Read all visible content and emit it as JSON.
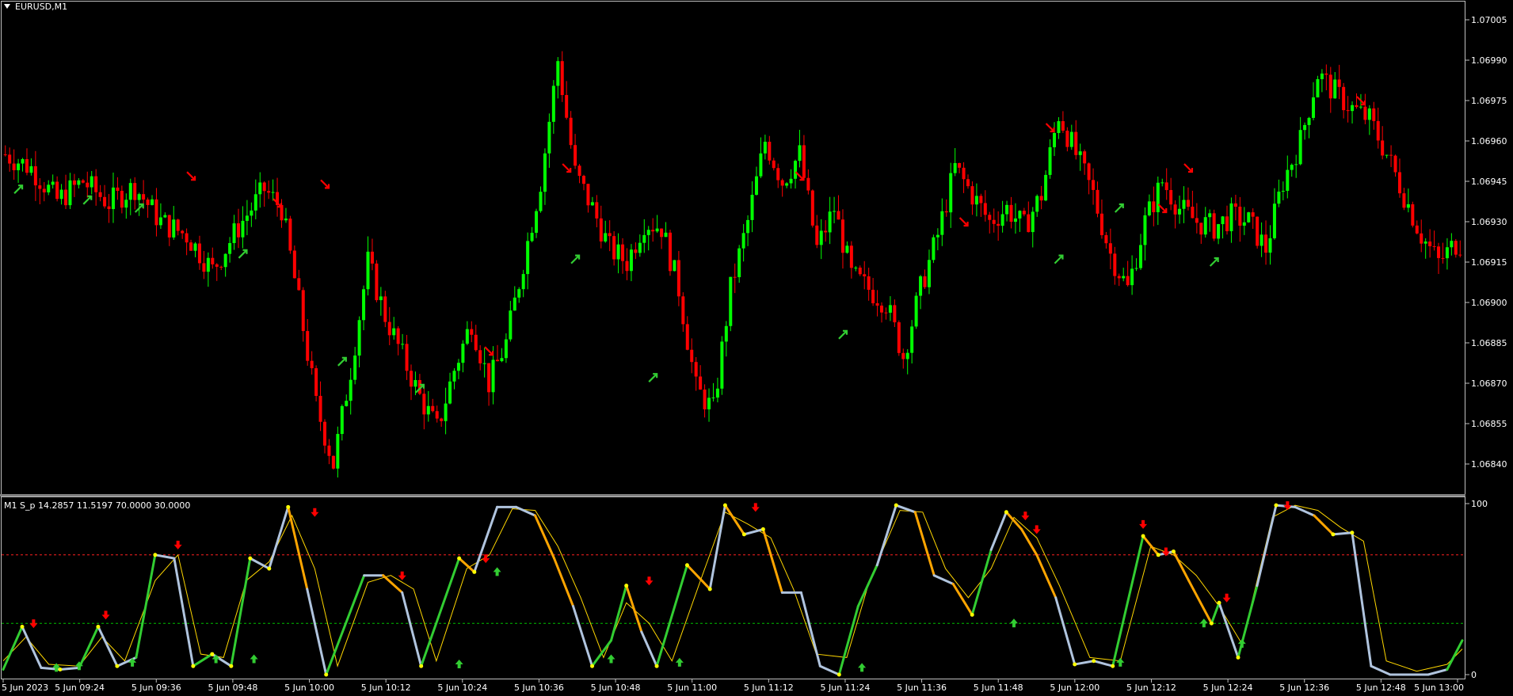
{
  "chart_window": {
    "symbol_label": "EURUSD,M1",
    "indicator_label": "M1 S_p 14.2857 11.5197 70.0000 30.0000"
  },
  "colors": {
    "background": "#000000",
    "frame": "#c0c0c0",
    "bull_candle": "#00ff00",
    "bear_candle": "#ff0000",
    "arrow_buy": "#32cd32",
    "arrow_sell": "#ff0000",
    "osc_main_up": "#32cd32",
    "osc_main_down": "#ffa500",
    "osc_main_flat": "#b0c4de",
    "osc_signal": "#ffd700",
    "level_high": "#ff2020",
    "level_low": "#00c000"
  },
  "chart_data": [
    {
      "type": "candlestick",
      "title": "EURUSD,M1",
      "ylim": [
        1.0683,
        1.0701
      ],
      "y_ticks": [
        "1.07005",
        "1.06990",
        "1.06975",
        "1.06960",
        "1.06945",
        "1.06930",
        "1.06915",
        "1.06900",
        "1.06885",
        "1.06870",
        "1.06855",
        "1.06840"
      ],
      "close_path": [
        [
          0,
          1.06955
        ],
        [
          6,
          1.0695
        ],
        [
          12,
          1.06938
        ],
        [
          18,
          1.06945
        ],
        [
          24,
          1.06937
        ],
        [
          30,
          1.06943
        ],
        [
          36,
          1.0693
        ],
        [
          42,
          1.06925
        ],
        [
          48,
          1.06912
        ],
        [
          54,
          1.06928
        ],
        [
          60,
          1.06942
        ],
        [
          64,
          1.06935
        ],
        [
          68,
          1.069
        ],
        [
          72,
          1.06862
        ],
        [
          76,
          1.0684
        ],
        [
          80,
          1.06875
        ],
        [
          84,
          1.06915
        ],
        [
          88,
          1.06895
        ],
        [
          92,
          1.0688
        ],
        [
          96,
          1.06865
        ],
        [
          100,
          1.06853
        ],
        [
          104,
          1.06875
        ],
        [
          108,
          1.06893
        ],
        [
          112,
          1.0687
        ],
        [
          116,
          1.06885
        ],
        [
          120,
          1.06915
        ],
        [
          124,
          1.06945
        ],
        [
          128,
          1.0699
        ],
        [
          132,
          1.06948
        ],
        [
          136,
          1.06935
        ],
        [
          140,
          1.0692
        ],
        [
          144,
          1.06915
        ],
        [
          148,
          1.0693
        ],
        [
          152,
          1.06928
        ],
        [
          156,
          1.06905
        ],
        [
          160,
          1.06868
        ],
        [
          164,
          1.0686
        ],
        [
          168,
          1.06905
        ],
        [
          172,
          1.0693
        ],
        [
          176,
          1.0696
        ],
        [
          180,
          1.06945
        ],
        [
          184,
          1.06955
        ],
        [
          188,
          1.0692
        ],
        [
          192,
          1.06935
        ],
        [
          196,
          1.0691
        ],
        [
          200,
          1.06905
        ],
        [
          204,
          1.069
        ],
        [
          208,
          1.0688
        ],
        [
          212,
          1.06905
        ],
        [
          216,
          1.06925
        ],
        [
          220,
          1.0695
        ],
        [
          224,
          1.0694
        ],
        [
          228,
          1.0693
        ],
        [
          232,
          1.06935
        ],
        [
          236,
          1.06928
        ],
        [
          240,
          1.0694
        ],
        [
          244,
          1.0697
        ],
        [
          248,
          1.06955
        ],
        [
          252,
          1.0694
        ],
        [
          256,
          1.06918
        ],
        [
          260,
          1.06905
        ],
        [
          264,
          1.0693
        ],
        [
          268,
          1.06945
        ],
        [
          272,
          1.06935
        ],
        [
          276,
          1.0693
        ],
        [
          280,
          1.06928
        ],
        [
          284,
          1.06932
        ],
        [
          288,
          1.0693
        ],
        [
          292,
          1.0692
        ],
        [
          296,
          1.06945
        ],
        [
          300,
          1.0696
        ],
        [
          304,
          1.06985
        ],
        [
          308,
          1.06978
        ],
        [
          312,
          1.06972
        ],
        [
          316,
          1.06968
        ],
        [
          320,
          1.06955
        ],
        [
          324,
          1.0694
        ],
        [
          328,
          1.06925
        ],
        [
          332,
          1.06915
        ],
        [
          336,
          1.06922
        ]
      ],
      "buy_arrows": [
        [
          3,
          1.06942
        ],
        [
          19,
          1.06938
        ],
        [
          31,
          1.06935
        ],
        [
          55,
          1.06918
        ],
        [
          78,
          1.06878
        ],
        [
          96,
          1.06868
        ],
        [
          132,
          1.06916
        ],
        [
          150,
          1.06872
        ],
        [
          194,
          1.06888
        ],
        [
          244,
          1.06916
        ],
        [
          258,
          1.06935
        ],
        [
          280,
          1.06915
        ]
      ],
      "sell_arrows": [
        [
          43,
          1.06947
        ],
        [
          63,
          1.06937
        ],
        [
          74,
          1.06944
        ],
        [
          112,
          1.06882
        ],
        [
          130,
          1.0695
        ],
        [
          184,
          1.06947
        ],
        [
          222,
          1.0693
        ],
        [
          242,
          1.06965
        ],
        [
          268,
          1.06935
        ],
        [
          274,
          1.0695
        ],
        [
          314,
          1.06975
        ]
      ],
      "x_ticks": [
        "5 Jun 2023",
        "5 Jun 09:24",
        "5 Jun 09:36",
        "5 Jun 09:48",
        "5 Jun 10:00",
        "5 Jun 10:12",
        "5 Jun 10:24",
        "5 Jun 10:36",
        "5 Jun 10:48",
        "5 Jun 11:00",
        "5 Jun 11:12",
        "5 Jun 11:24",
        "5 Jun 11:36",
        "5 Jun 11:48",
        "5 Jun 12:00",
        "5 Jun 12:12",
        "5 Jun 12:24",
        "5 Jun 12:36",
        "5 Jun 12:48",
        "5 Jun 13:00"
      ]
    },
    {
      "type": "line",
      "title": "M1 S_p 14.2857 11.5197 70.0000 30.0000",
      "ylim": [
        0,
        100
      ],
      "y_ticks": [
        "100",
        "0"
      ],
      "levels": [
        70,
        30
      ],
      "main": [
        [
          0,
          3
        ],
        [
          5,
          28
        ],
        [
          10,
          4
        ],
        [
          15,
          3
        ],
        [
          20,
          4
        ],
        [
          25,
          28
        ],
        [
          30,
          5
        ],
        [
          35,
          10
        ],
        [
          40,
          70
        ],
        [
          45,
          68
        ],
        [
          50,
          5
        ],
        [
          55,
          12
        ],
        [
          60,
          5
        ],
        [
          65,
          68
        ],
        [
          70,
          62
        ],
        [
          75,
          98
        ],
        [
          80,
          50
        ],
        [
          85,
          0
        ],
        [
          95,
          58
        ],
        [
          100,
          58
        ],
        [
          105,
          48
        ],
        [
          110,
          5
        ],
        [
          120,
          68
        ],
        [
          124,
          60
        ],
        [
          130,
          98
        ],
        [
          135,
          98
        ],
        [
          140,
          93
        ],
        [
          145,
          68
        ],
        [
          150,
          40
        ],
        [
          155,
          5
        ],
        [
          160,
          20
        ],
        [
          164,
          52
        ],
        [
          168,
          25
        ],
        [
          172,
          5
        ],
        [
          180,
          64
        ],
        [
          186,
          50
        ],
        [
          190,
          99
        ],
        [
          195,
          82
        ],
        [
          200,
          85
        ],
        [
          205,
          48
        ],
        [
          210,
          48
        ],
        [
          215,
          5
        ],
        [
          220,
          0
        ],
        [
          225,
          40
        ],
        [
          230,
          64
        ],
        [
          235,
          99
        ],
        [
          240,
          95
        ],
        [
          245,
          58
        ],
        [
          250,
          53
        ],
        [
          255,
          35
        ],
        [
          260,
          73
        ],
        [
          264,
          95
        ],
        [
          268,
          85
        ],
        [
          272,
          70
        ],
        [
          277,
          45
        ],
        [
          282,
          6
        ],
        [
          287,
          8
        ],
        [
          292,
          5
        ],
        [
          300,
          81
        ],
        [
          304,
          70
        ],
        [
          308,
          72
        ],
        [
          312,
          55
        ],
        [
          318,
          30
        ],
        [
          320,
          42
        ],
        [
          325,
          10
        ],
        [
          330,
          52
        ],
        [
          335,
          99
        ],
        [
          340,
          98
        ],
        [
          345,
          93
        ],
        [
          350,
          82
        ],
        [
          355,
          83
        ],
        [
          360,
          5
        ],
        [
          365,
          0
        ],
        [
          375,
          0
        ],
        [
          380,
          3
        ],
        [
          384,
          20
        ]
      ],
      "signal": [
        [
          0,
          8
        ],
        [
          6,
          22
        ],
        [
          12,
          6
        ],
        [
          20,
          5
        ],
        [
          26,
          22
        ],
        [
          32,
          8
        ],
        [
          40,
          55
        ],
        [
          46,
          70
        ],
        [
          52,
          12
        ],
        [
          58,
          10
        ],
        [
          64,
          55
        ],
        [
          70,
          66
        ],
        [
          76,
          93
        ],
        [
          82,
          62
        ],
        [
          88,
          5
        ],
        [
          96,
          54
        ],
        [
          102,
          58
        ],
        [
          108,
          50
        ],
        [
          114,
          8
        ],
        [
          122,
          62
        ],
        [
          128,
          70
        ],
        [
          134,
          97
        ],
        [
          140,
          96
        ],
        [
          146,
          75
        ],
        [
          152,
          45
        ],
        [
          158,
          10
        ],
        [
          164,
          42
        ],
        [
          170,
          30
        ],
        [
          176,
          8
        ],
        [
          184,
          58
        ],
        [
          190,
          95
        ],
        [
          196,
          88
        ],
        [
          202,
          80
        ],
        [
          208,
          50
        ],
        [
          214,
          12
        ],
        [
          222,
          10
        ],
        [
          228,
          55
        ],
        [
          236,
          96
        ],
        [
          242,
          95
        ],
        [
          248,
          62
        ],
        [
          254,
          45
        ],
        [
          260,
          62
        ],
        [
          266,
          92
        ],
        [
          272,
          80
        ],
        [
          278,
          52
        ],
        [
          286,
          10
        ],
        [
          294,
          8
        ],
        [
          302,
          75
        ],
        [
          308,
          70
        ],
        [
          314,
          58
        ],
        [
          320,
          40
        ],
        [
          326,
          18
        ],
        [
          334,
          92
        ],
        [
          340,
          99
        ],
        [
          346,
          96
        ],
        [
          352,
          86
        ],
        [
          358,
          78
        ],
        [
          364,
          8
        ],
        [
          372,
          2
        ],
        [
          380,
          6
        ],
        [
          384,
          15
        ]
      ],
      "buy_markers": [
        [
          14,
          4
        ],
        [
          20,
          5
        ],
        [
          34,
          7
        ],
        [
          56,
          9
        ],
        [
          66,
          9
        ],
        [
          120,
          6
        ],
        [
          130,
          60
        ],
        [
          160,
          9
        ],
        [
          178,
          7
        ],
        [
          226,
          4
        ],
        [
          266,
          30
        ],
        [
          294,
          7
        ],
        [
          316,
          30
        ],
        [
          326,
          18
        ]
      ],
      "sell_markers": [
        [
          8,
          30
        ],
        [
          27,
          35
        ],
        [
          46,
          76
        ],
        [
          82,
          95
        ],
        [
          105,
          58
        ],
        [
          127,
          68
        ],
        [
          170,
          55
        ],
        [
          198,
          98
        ],
        [
          269,
          93
        ],
        [
          272,
          85
        ],
        [
          300,
          88
        ],
        [
          306,
          72
        ],
        [
          322,
          45
        ],
        [
          338,
          99
        ]
      ]
    }
  ]
}
